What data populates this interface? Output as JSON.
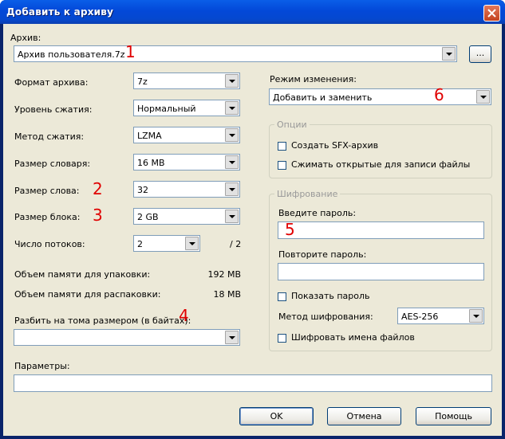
{
  "window": {
    "title": "Добавить к архиву"
  },
  "archive": {
    "label": "Архив:",
    "value": "Архив пользователя.7z",
    "browse_label": "..."
  },
  "format": {
    "label": "Формат архива:",
    "value": "7z"
  },
  "level": {
    "label": "Уровень сжатия:",
    "value": "Нормальный"
  },
  "method": {
    "label": "Метод сжатия:",
    "value": "LZMA"
  },
  "dict": {
    "label": "Размер словаря:",
    "value": "16 MB"
  },
  "word": {
    "label": "Размер слова:",
    "value": "32"
  },
  "block": {
    "label": "Размер блока:",
    "value": "2 GB"
  },
  "threads": {
    "label": "Число потоков:",
    "value": "2",
    "max": "/ 2"
  },
  "memory": {
    "pack_label": "Объем памяти для упаковки:",
    "pack_value": "192 MB",
    "unpack_label": "Объем памяти для распаковки:",
    "unpack_value": "18 MB"
  },
  "split": {
    "label": "Разбить на тома размером (в байтах):",
    "value": ""
  },
  "params": {
    "label": "Параметры:",
    "value": ""
  },
  "update": {
    "label": "Режим изменения:",
    "value": "Добавить и заменить"
  },
  "options": {
    "title": "Опции",
    "sfx_label": "Создать SFX-архив",
    "shared_label": "Сжимать открытые для записи файлы"
  },
  "encryption": {
    "title": "Шифрование",
    "password_label": "Введите пароль:",
    "password_value": "",
    "repeat_label": "Повторите пароль:",
    "repeat_value": "",
    "show_label": "Показать пароль",
    "method_label": "Метод шифрования:",
    "method_value": "AES-256",
    "encrypt_names_label": "Шифровать имена файлов"
  },
  "buttons": {
    "ok": "OK",
    "cancel": "Отмена",
    "help": "Помощь"
  },
  "annotations": [
    "1",
    "2",
    "3",
    "4",
    "5",
    "6"
  ],
  "colors": {
    "annotation": "#e00000",
    "titlebar": "#0348d8",
    "dialog": "#ece9d8"
  }
}
